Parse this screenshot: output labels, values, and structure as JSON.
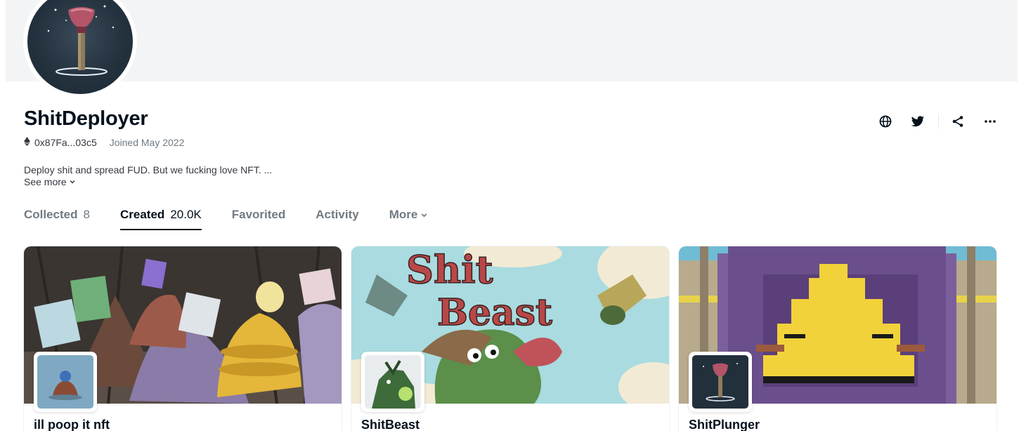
{
  "profile": {
    "name": "ShitDeployer",
    "wallet": "0x87Fa...03c5",
    "joined": "Joined May 2022",
    "bio": "Deploy shit and spread FUD. But we fucking love NFT. ...",
    "see_more": "See more"
  },
  "tabs": [
    {
      "label": "Collected",
      "count": "8",
      "active": false
    },
    {
      "label": "Created",
      "count": "20.0K",
      "active": true
    },
    {
      "label": "Favorited",
      "count": "",
      "active": false
    },
    {
      "label": "Activity",
      "count": "",
      "active": false
    },
    {
      "label": "More",
      "count": "",
      "active": false
    }
  ],
  "actions": [
    "globe-icon",
    "twitter-icon",
    "share-icon",
    "more-icon"
  ],
  "collections": [
    {
      "title": "ill poop it nft",
      "banner_art": "purple-cartoon-poop-piles",
      "logo_art": "small-poop-figure"
    },
    {
      "title": "ShitBeast",
      "banner_art": "shit-beast-lettering",
      "logo_art": "green-creature"
    },
    {
      "title": "ShitPlunger",
      "banner_art": "pixel-gold-poop",
      "logo_art": "plunger"
    }
  ],
  "colors": {
    "text": "#04111d",
    "muted": "#707a83",
    "banner": "#f3f4f6"
  }
}
